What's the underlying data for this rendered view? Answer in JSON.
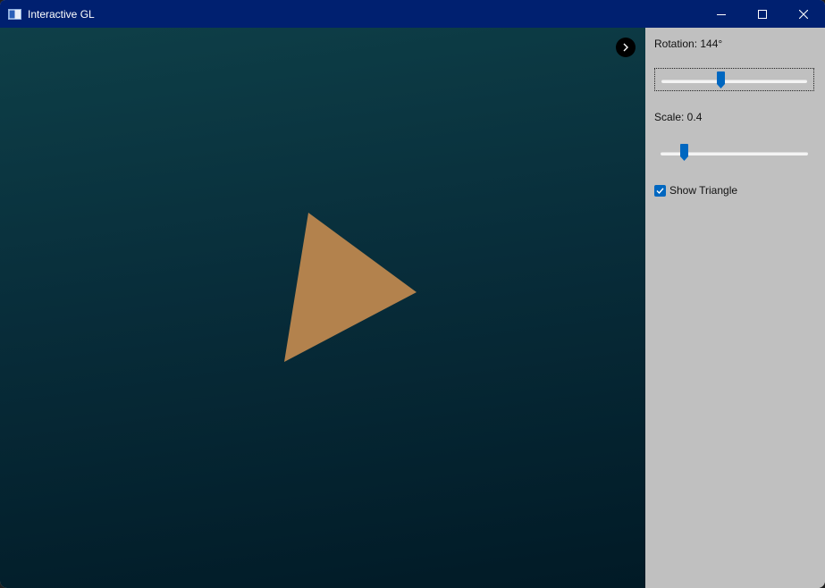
{
  "window": {
    "title": "Interactive GL"
  },
  "titlebar": {
    "icons": [
      "app-icon",
      "minimize-icon",
      "maximize-icon",
      "close-icon"
    ]
  },
  "viewport": {
    "collapse_icon": "chevron-right-icon",
    "background_colors": [
      "#0e3f48",
      "#011a26"
    ],
    "triangle": {
      "visible": true,
      "color": "#b3824d",
      "rotation_deg": 144,
      "scale": 0.4
    }
  },
  "controls": {
    "rotation_label": "Rotation: 144°",
    "rotation": {
      "value": 144,
      "min": 0,
      "max": 360
    },
    "scale_label": "Scale: 0.4",
    "scale": {
      "value": 0.4,
      "min": 0.1,
      "max": 2.0
    },
    "show_triangle_label": "Show Triangle",
    "show_triangle_checked": true,
    "accent_color": "#0067c0"
  }
}
